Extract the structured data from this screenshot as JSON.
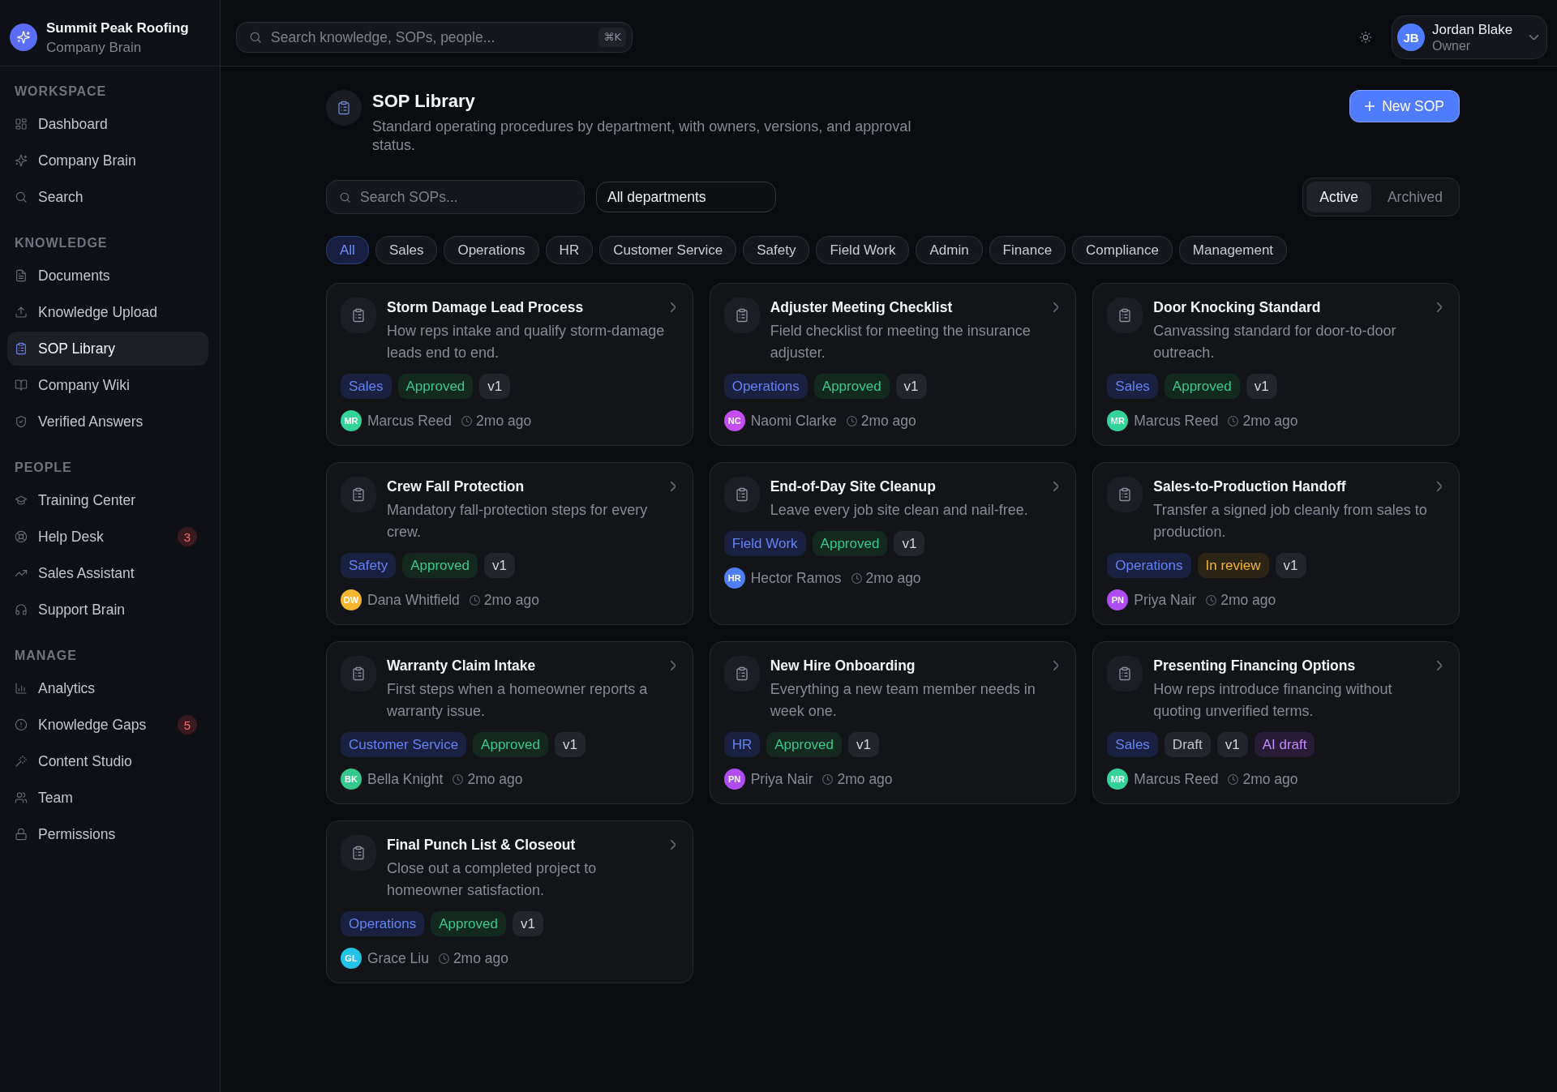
{
  "brand": {
    "name": "Summit Peak Roofing",
    "subtitle": "Company Brain"
  },
  "sidebar": {
    "sections": [
      {
        "title": "WORKSPACE",
        "items": [
          {
            "label": "Dashboard",
            "selected": false
          },
          {
            "label": "Company Brain",
            "selected": false
          },
          {
            "label": "Search",
            "selected": false
          }
        ]
      },
      {
        "title": "KNOWLEDGE",
        "items": [
          {
            "label": "Documents",
            "selected": false
          },
          {
            "label": "Knowledge Upload",
            "selected": false
          },
          {
            "label": "SOP Library",
            "selected": true
          },
          {
            "label": "Company Wiki",
            "selected": false
          },
          {
            "label": "Verified Answers",
            "selected": false
          }
        ]
      },
      {
        "title": "PEOPLE",
        "items": [
          {
            "label": "Training Center",
            "selected": false
          },
          {
            "label": "Help Desk",
            "selected": false,
            "badge": "3"
          },
          {
            "label": "Sales Assistant",
            "selected": false
          },
          {
            "label": "Support Brain",
            "selected": false
          }
        ]
      },
      {
        "title": "MANAGE",
        "items": [
          {
            "label": "Analytics",
            "selected": false
          },
          {
            "label": "Knowledge Gaps",
            "selected": false,
            "badge": "5"
          },
          {
            "label": "Content Studio",
            "selected": false
          },
          {
            "label": "Team",
            "selected": false
          },
          {
            "label": "Permissions",
            "selected": false
          }
        ]
      }
    ]
  },
  "topbar": {
    "search": {
      "placeholder": "Search knowledge, SOPs, people...",
      "shortcut": "⌘K"
    },
    "user": {
      "initials": "JB",
      "name": "Jordan Blake",
      "role": "Owner"
    }
  },
  "page": {
    "title": "SOP Library",
    "subtitle": "Standard operating procedures by department, with owners, versions, and approval status.",
    "new_button": "New SOP"
  },
  "filters": {
    "search": {
      "placeholder": "Search SOPs..."
    },
    "department": {
      "value": "All departments"
    },
    "status_tabs": [
      {
        "label": "Active",
        "selected": true
      },
      {
        "label": "Archived",
        "selected": false
      }
    ]
  },
  "categories": [
    {
      "label": "All",
      "selected": true
    },
    {
      "label": "Sales",
      "selected": false
    },
    {
      "label": "Operations",
      "selected": false
    },
    {
      "label": "HR",
      "selected": false
    },
    {
      "label": "Customer Service",
      "selected": false
    },
    {
      "label": "Safety",
      "selected": false
    },
    {
      "label": "Field Work",
      "selected": false
    },
    {
      "label": "Admin",
      "selected": false
    },
    {
      "label": "Finance",
      "selected": false
    },
    {
      "label": "Compliance",
      "selected": false
    },
    {
      "label": "Management",
      "selected": false
    }
  ],
  "cards": [
    {
      "title": "Storm Damage Lead Process",
      "description": "How reps intake and qualify storm-damage leads end to end.",
      "tags": [
        {
          "text": "Sales",
          "kind": "department"
        },
        {
          "text": "Approved",
          "kind": "approved"
        },
        {
          "text": "v1",
          "kind": "version"
        }
      ],
      "author": {
        "initials": "MR",
        "name": "Marcus Reed",
        "color": "#34d399"
      },
      "updated": "2mo ago"
    },
    {
      "title": "Adjuster Meeting Checklist",
      "description": "Field checklist for meeting the insurance adjuster.",
      "tags": [
        {
          "text": "Operations",
          "kind": "department"
        },
        {
          "text": "Approved",
          "kind": "approved"
        },
        {
          "text": "v1",
          "kind": "version"
        }
      ],
      "author": {
        "initials": "NC",
        "name": "Naomi Clarke",
        "color": "#c44cf0"
      },
      "updated": "2mo ago"
    },
    {
      "title": "Door Knocking Standard",
      "description": "Canvassing standard for door-to-door outreach.",
      "tags": [
        {
          "text": "Sales",
          "kind": "department"
        },
        {
          "text": "Approved",
          "kind": "approved"
        },
        {
          "text": "v1",
          "kind": "version"
        }
      ],
      "author": {
        "initials": "MR",
        "name": "Marcus Reed",
        "color": "#34d399"
      },
      "updated": "2mo ago"
    },
    {
      "title": "Crew Fall Protection",
      "description": "Mandatory fall-protection steps for every crew.",
      "tags": [
        {
          "text": "Safety",
          "kind": "department"
        },
        {
          "text": "Approved",
          "kind": "approved"
        },
        {
          "text": "v1",
          "kind": "version"
        }
      ],
      "author": {
        "initials": "DW",
        "name": "Dana Whitfield",
        "color": "#f5b731"
      },
      "updated": "2mo ago"
    },
    {
      "title": "End-of-Day Site Cleanup",
      "description": "Leave every job site clean and nail-free.",
      "tags": [
        {
          "text": "Field Work",
          "kind": "department"
        },
        {
          "text": "Approved",
          "kind": "approved"
        },
        {
          "text": "v1",
          "kind": "version"
        }
      ],
      "author": {
        "initials": "HR",
        "name": "Hector Ramos",
        "color": "#4f7ff5"
      },
      "updated": "2mo ago"
    },
    {
      "title": "Sales-to-Production Handoff",
      "description": "Transfer a signed job cleanly from sales to production.",
      "tags": [
        {
          "text": "Operations",
          "kind": "department"
        },
        {
          "text": "In review",
          "kind": "review"
        },
        {
          "text": "v1",
          "kind": "version"
        }
      ],
      "author": {
        "initials": "PN",
        "name": "Priya Nair",
        "color": "#b04cf2"
      },
      "updated": "2mo ago"
    },
    {
      "title": "Warranty Claim Intake",
      "description": "First steps when a homeowner reports a warranty issue.",
      "tags": [
        {
          "text": "Customer Service",
          "kind": "department"
        },
        {
          "text": "Approved",
          "kind": "approved"
        },
        {
          "text": "v1",
          "kind": "version"
        }
      ],
      "author": {
        "initials": "BK",
        "name": "Bella Knight",
        "color": "#34c98a"
      },
      "updated": "2mo ago"
    },
    {
      "title": "New Hire Onboarding",
      "description": "Everything a new team member needs in week one.",
      "tags": [
        {
          "text": "HR",
          "kind": "department"
        },
        {
          "text": "Approved",
          "kind": "approved"
        },
        {
          "text": "v1",
          "kind": "version"
        }
      ],
      "author": {
        "initials": "PN",
        "name": "Priya Nair",
        "color": "#b04cf2"
      },
      "updated": "2mo ago"
    },
    {
      "title": "Presenting Financing Options",
      "description": "How reps introduce financing without quoting unverified terms.",
      "tags": [
        {
          "text": "Sales",
          "kind": "department"
        },
        {
          "text": "Draft",
          "kind": "draft"
        },
        {
          "text": "v1",
          "kind": "version"
        },
        {
          "text": "AI draft",
          "kind": "ai"
        }
      ],
      "author": {
        "initials": "MR",
        "name": "Marcus Reed",
        "color": "#34d399"
      },
      "updated": "2mo ago"
    },
    {
      "title": "Final Punch List & Closeout",
      "description": "Close out a completed project to homeowner satisfaction.",
      "tags": [
        {
          "text": "Operations",
          "kind": "department"
        },
        {
          "text": "Approved",
          "kind": "approved"
        },
        {
          "text": "v1",
          "kind": "version"
        }
      ],
      "author": {
        "initials": "GL",
        "name": "Grace Liu",
        "color": "#22c3e6"
      },
      "updated": "2mo ago"
    }
  ]
}
